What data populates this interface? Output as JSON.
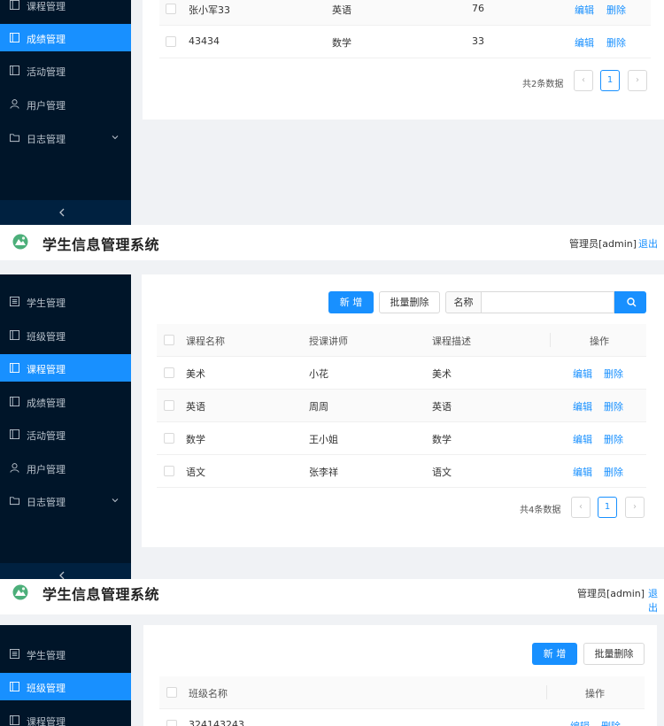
{
  "app": {
    "title": "学生信息管理系统",
    "admin": "管理员[admin]",
    "logout": "退出"
  },
  "colors": {
    "sidebar": "#001529",
    "accent": "#1890ff",
    "link": "#1890ff"
  },
  "nav": {
    "students": "学生管理",
    "classes": "班级管理",
    "courses": "课程管理",
    "grades": "成绩管理",
    "activities": "活动管理",
    "users": "用户管理",
    "logs": "日志管理"
  },
  "actions": {
    "add": "新 增",
    "batch_delete": "批量删除",
    "edit": "编辑",
    "delete": "删除",
    "search_label": "名称",
    "search_placeholder": ""
  },
  "grades_view": {
    "rows": [
      {
        "name": "张小军33",
        "course": "英语",
        "score": "76"
      },
      {
        "name": "43434",
        "course": "数学",
        "score": "33"
      }
    ],
    "total": "共2条数据",
    "page": "1"
  },
  "courses_view": {
    "columns": [
      "课程名称",
      "授课讲师",
      "课程描述",
      "操作"
    ],
    "rows": [
      {
        "name": "美术",
        "teacher": "小花",
        "desc": "美术"
      },
      {
        "name": "英语",
        "teacher": "周周",
        "desc": "英语"
      },
      {
        "name": "数学",
        "teacher": "王小姐",
        "desc": "数学"
      },
      {
        "name": "语文",
        "teacher": "张李祥",
        "desc": "语文"
      }
    ],
    "total": "共4条数据",
    "page": "1"
  },
  "classes_view": {
    "columns": [
      "班级名称",
      "操作"
    ],
    "rows": [
      {
        "name": "324143243"
      }
    ]
  },
  "pager": {
    "prev": "‹",
    "next": "›"
  }
}
